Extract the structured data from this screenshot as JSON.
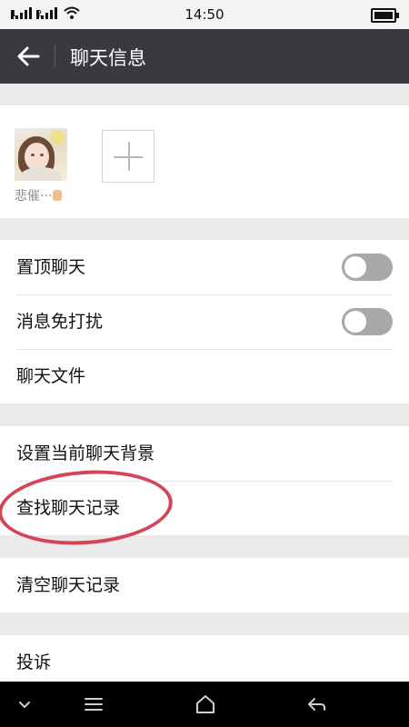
{
  "status_bar": {
    "time": "14:50",
    "sim1": "1",
    "sim2": "2"
  },
  "app_bar": {
    "title": "聊天信息"
  },
  "members": [
    {
      "name": "悲催···"
    }
  ],
  "settings": {
    "pin_chat": {
      "label": "置顶聊天",
      "enabled": false
    },
    "do_not_disturb": {
      "label": "消息免打扰",
      "enabled": false
    },
    "chat_files": {
      "label": "聊天文件"
    },
    "set_background": {
      "label": "设置当前聊天背景"
    },
    "search_history": {
      "label": "查找聊天记录"
    },
    "clear_history": {
      "label": "清空聊天记录"
    },
    "report": {
      "label": "投诉"
    }
  },
  "colors": {
    "app_bar": "#393a3f",
    "highlight_circle": "#d64458",
    "toggle_off": "#a8a8a8"
  }
}
